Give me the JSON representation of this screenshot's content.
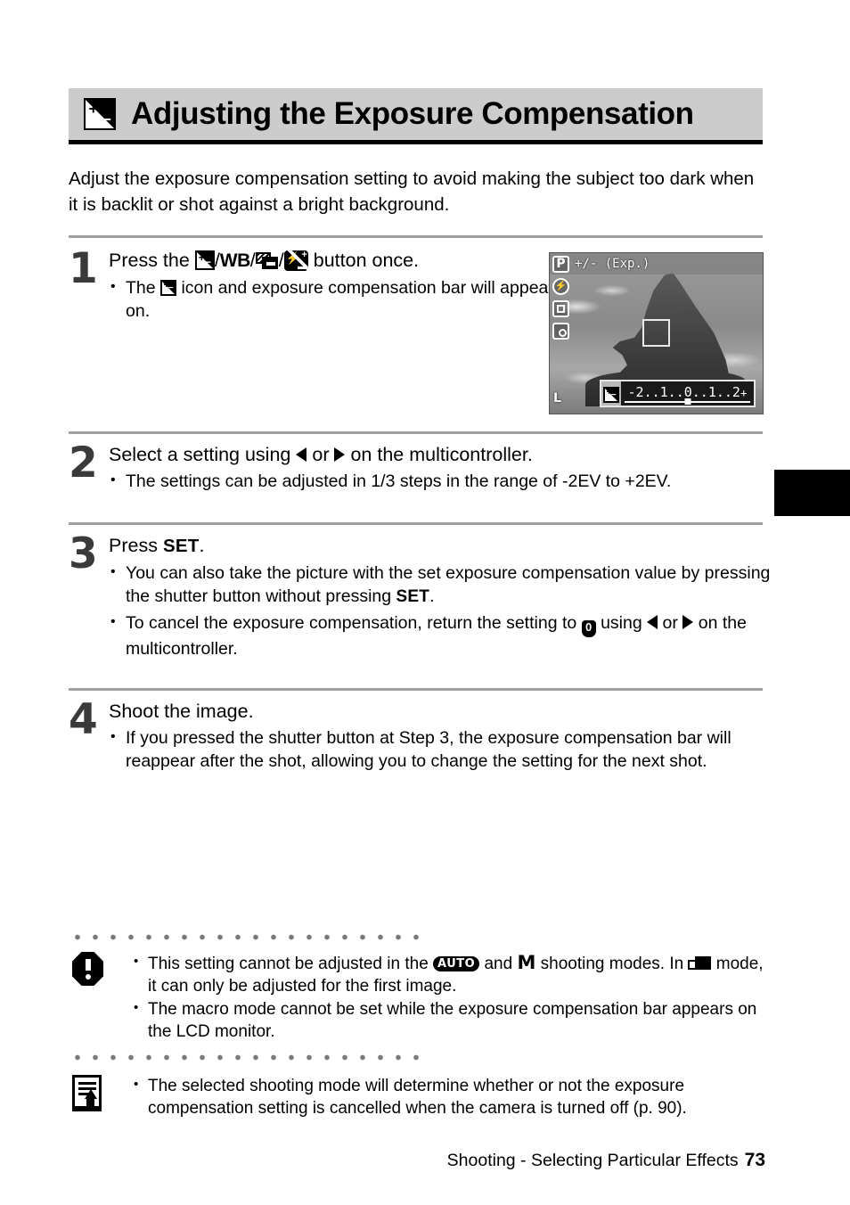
{
  "header": {
    "icon": "exposure-compensation-icon",
    "title": "Adjusting the Exposure Compensation"
  },
  "intro": "Adjust the exposure compensation setting to avoid making the subject too dark when it is backlit or shot against a bright background.",
  "steps": [
    {
      "number": "1",
      "head_prefix": "Press the",
      "head_suffix": "button once.",
      "icons": [
        "exposure-comp-icon",
        "WB",
        "drive-mode-icon",
        "flash-exposure-comp-icon"
      ],
      "bullets": [
        {
          "pre": "The",
          "post": "icon and exposure compensation bar will appear on the LCD monitor if it is on."
        }
      ]
    },
    {
      "number": "2",
      "head_a": "Select a setting using",
      "head_or": "or",
      "head_b": "on the multicontroller.",
      "bullets": [
        "The settings can be adjusted in 1/3 steps in the range of -2EV to +2EV."
      ]
    },
    {
      "number": "3",
      "head_pre": "Press",
      "head_set": "SET",
      "head_post": ".",
      "bullets": [
        {
          "a": "You can also take the picture with the set exposure compensation value by pressing the shutter button without pressing",
          "set": "SET",
          "b": "."
        },
        {
          "a": "To cancel the exposure compensation, return the setting to",
          "mid": "using",
          "or": "or",
          "b": "on the multicontroller."
        }
      ]
    },
    {
      "number": "4",
      "head": "Shoot the image.",
      "bullets": [
        "If you pressed the shutter button at Step 3, the exposure compensation bar will reappear after the shot, allowing you to change the setting for the next shot."
      ]
    }
  ],
  "lcd": {
    "mode_icon": "P",
    "exposure_label": "+/- (Exp.)",
    "quality_label": "L",
    "ec_scale": "-2..1..0..1..2",
    "ec_scale_plus": "+",
    "side_icons": [
      "flash-off-icon",
      "single-shot-icon",
      "metering-icon"
    ]
  },
  "warning_note": {
    "icon": "warning-icon",
    "bullets": [
      {
        "a": "This setting cannot be adjusted in the",
        "auto": "AUTO",
        "b": "and",
        "m": "M",
        "c": "shooting modes. In",
        "stitch": "stitch-assist-icon",
        "d": "mode, it can only be adjusted for the first image."
      },
      "The macro mode cannot be set while the exposure compensation bar appears on the LCD monitor."
    ]
  },
  "memo_note": {
    "icon": "memo-icon",
    "bullets": [
      "The selected shooting mode will determine whether or not the exposure compensation setting is cancelled when the camera is turned off (p. 90)."
    ]
  },
  "footer": {
    "section": "Shooting - Selecting Particular Effects",
    "page": "73"
  },
  "colors": {
    "header_band": "#cccccc",
    "rule": "#a0a0a0",
    "step_number": "#3a3a3a",
    "tab": "#000000"
  }
}
